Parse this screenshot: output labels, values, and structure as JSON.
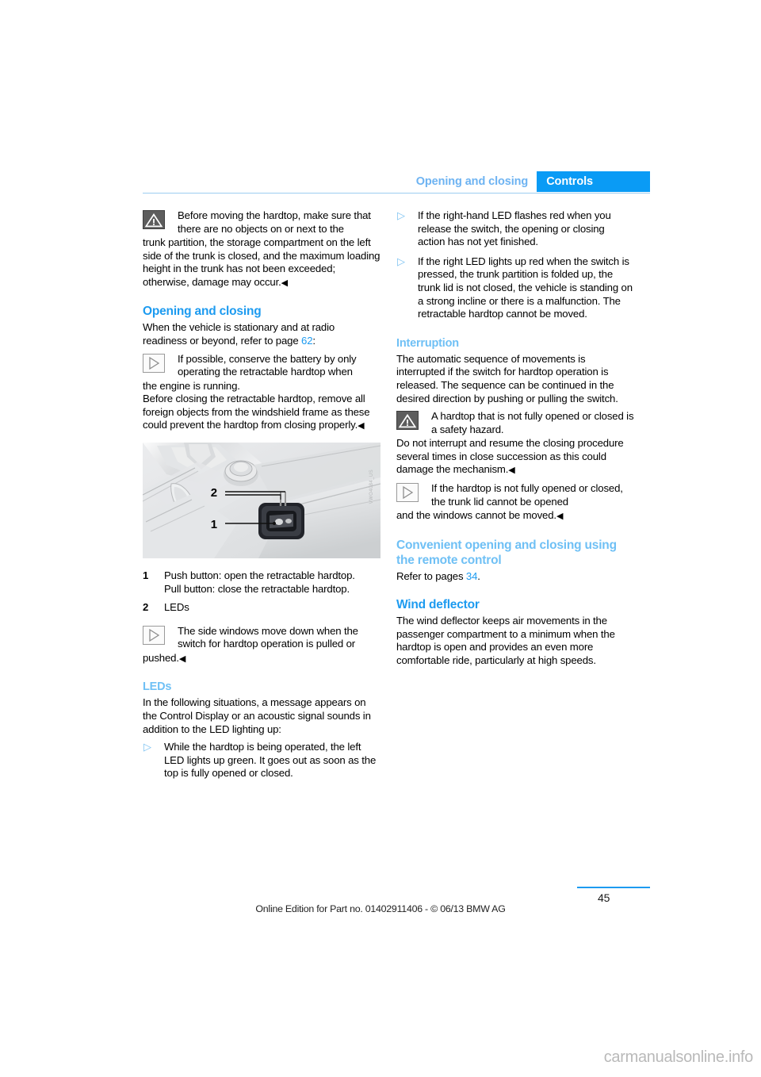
{
  "header": {
    "section_label": "Opening and closing",
    "chapter_label": "Controls",
    "accent_blue": "#0a9bf5",
    "section_blue": "#6db3f2"
  },
  "left_column": {
    "warning_1": {
      "icon": "warning-triangle-icon",
      "text_indented": "Before moving the hardtop, make sure that there are no objects on or next to the",
      "text_full": "trunk partition, the storage compartment on the left side of the trunk is closed, and the maximum loading height in the trunk has not been exceeded; otherwise, damage may occur.",
      "endmark": "◀"
    },
    "heading_opening_closing": "Opening and closing",
    "intro_part1": "When the vehicle is stationary and at radio readiness or beyond, refer to page ",
    "intro_page_ref": "62",
    "intro_part2": ":",
    "note_1": {
      "icon": "note-play-icon",
      "text_indented": "If possible, conserve the battery by only operating the retractable hardtop when",
      "text_full": "the engine is running.",
      "text_extra": "Before closing the retractable hardtop, remove all foreign objects from the windshield frame as these could prevent the hardtop from closing properly.",
      "endmark": "◀"
    },
    "figure": {
      "alt": "Center console with retractable hardtop switch",
      "callout_1": "1",
      "callout_2": "2",
      "watermark": "VWO4084_US"
    },
    "legend": [
      {
        "number": "1",
        "line1": "Push button: open the retractable hardtop.",
        "line2": "Pull button: close the retractable hardtop."
      },
      {
        "number": "2",
        "line1": "LEDs",
        "line2": ""
      }
    ],
    "note_2": {
      "icon": "note-play-icon",
      "text_indented": "The side windows move down when the switch for hardtop operation is pulled or",
      "text_full": "pushed.",
      "endmark": "◀"
    },
    "heading_leds": "LEDs",
    "leds_intro": "In the following situations, a message appears on the Control Display or an acoustic signal sounds in addition to the LED lighting up:",
    "leds_bullets": [
      "While the hardtop is being operated, the left LED lights up green. It goes out as soon as the top is fully opened or closed."
    ]
  },
  "right_column": {
    "bullets_top": [
      "If the right-hand LED flashes red when you release the switch, the opening or closing action has not yet finished.",
      "If the right LED lights up red when the switch is pressed, the trunk partition is folded up, the trunk lid is not closed, the vehicle is standing on a strong incline or there is a malfunction. The retractable hardtop cannot be moved."
    ],
    "heading_interruption": "Interruption",
    "interruption_text": "The automatic sequence of movements is interrupted if the switch for hardtop operation is released. The sequence can be continued in the desired direction by pushing or pulling the switch.",
    "warning_2": {
      "icon": "warning-triangle-icon",
      "text_indented": "A hardtop that is not fully opened or closed is a safety hazard.",
      "text_full": "Do not interrupt and resume the closing procedure several times in close succession as this could damage the mechanism.",
      "endmark": "◀"
    },
    "note_3": {
      "icon": "note-play-icon",
      "text_indented": "If the hardtop is not fully opened or closed, the trunk lid cannot be opened",
      "text_full": "and the windows cannot be moved.",
      "endmark": "◀"
    },
    "heading_remote": "Convenient opening and closing using the remote control",
    "remote_text_part1": "Refer to pages ",
    "remote_page_ref": "34",
    "remote_text_part2": ".",
    "heading_wind_deflector": "Wind deflector",
    "wind_deflector_text": "The wind deflector keeps air movements in the passenger compartment to a minimum when the hardtop is open and provides an even more comfortable ride, particularly at high speeds."
  },
  "footer": {
    "page_number": "45",
    "edition_note": "Online Edition for Part no. 01402911406 - © 06/13 BMW AG",
    "site_watermark": "carmanualsonline.info"
  }
}
